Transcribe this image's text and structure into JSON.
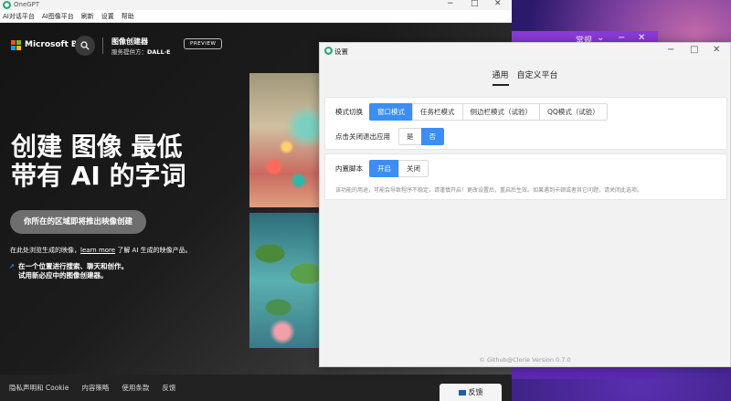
{
  "main_window": {
    "title": "OneGPT",
    "menu": [
      "AI对话平台",
      "AI图像平台",
      "刷新",
      "设置",
      "帮助"
    ]
  },
  "bing": {
    "brand": "Microsoft Bing",
    "creator_title": "图像创建器",
    "creator_sub_prefix": "服务提供方：",
    "creator_sub_provider": "DALL·E",
    "preview_badge": "PREVIEW",
    "hero_line1": "创建 图像 最低",
    "hero_line2": "带有 AI 的字词",
    "cta_label": "你所在的区域即将推出映像创建",
    "info_prefix": "在此处浏览生成的映像，",
    "info_link": "learn more",
    "info_suffix": " 了解 AI 生成的映像产品。",
    "bullet_line1": "在一个位置进行搜索、聊天和创作。",
    "bullet_line2": "试用新必应中的图像创建器。",
    "footer_links": [
      "隐私声明和 Cookie",
      "内容策略",
      "使用条款",
      "反馈"
    ],
    "feedback_button": "反馈"
  },
  "background_app": {
    "label": "常规"
  },
  "settings": {
    "title": "设置",
    "tabs": [
      "通用",
      "自定义平台"
    ],
    "mode_label": "模式切换",
    "mode_options": [
      "窗口模式",
      "任务栏模式",
      "侧边栏模式（试验）",
      "QQ模式（试验）"
    ],
    "exit_label": "点击关闭退出应用",
    "exit_options": [
      "是",
      "否"
    ],
    "script_label": "内置脚本",
    "script_options": [
      "开启",
      "关闭"
    ],
    "script_hint": "该功能的用途，可能会导致程序不稳定，请谨慎开启！更改设置后，重启后生效。如果遇到卡顿或者其它问题，请关闭此选项。",
    "footer": "© Github@Clorie Version 0.7.0"
  },
  "colors": {
    "accent": "#3a8ef5",
    "bing_dark": "#1b1b1b"
  }
}
